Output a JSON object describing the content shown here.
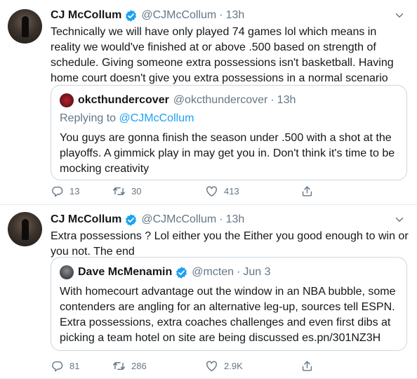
{
  "tweets": [
    {
      "author": {
        "name": "CJ McCollum",
        "handle": "@CJMcCollum"
      },
      "time": "13h",
      "text": "Technically we will have only played 74 games lol which means in reality we would've finished at or above .500 based on strength of schedule. Giving someone extra possessions isn't basketball. Having home court doesn't give you extra possessions in a normal scenario",
      "quote": {
        "author": {
          "name": "okcthundercover",
          "handle": "@okcthundercover"
        },
        "time": "13h",
        "replying_prefix": "Replying to",
        "replying_to": "@CJMcCollum",
        "text": "You guys are gonna finish the season under .500 with a shot at the playoffs. A gimmick play in may get you in. Don't think it's time to be mocking creativity"
      },
      "stats": {
        "replies": "13",
        "retweets": "30",
        "likes": "413"
      }
    },
    {
      "author": {
        "name": "CJ McCollum",
        "handle": "@CJMcCollum"
      },
      "time": "13h",
      "text": "Extra possessions ? Lol either you the Either you good enough to win or you not. The end",
      "quote": {
        "author": {
          "name": "Dave McMenamin",
          "handle": "@mcten"
        },
        "time": "Jun 3",
        "text": "With homecourt advantage out the window in an NBA bubble, some contenders are angling for an alternative leg-up, sources tell ESPN. Extra possessions, extra coaches challenges and even first dibs at picking a team hotel on site are being discussed es.pn/301NZ3H"
      },
      "stats": {
        "replies": "81",
        "retweets": "286",
        "likes": "2.9K"
      }
    }
  ],
  "separator": "·",
  "colors": {
    "accent": "#1da1f2",
    "secondary_text": "#657786",
    "border": "#ccd6dd"
  },
  "icons": [
    "verified-badge-icon",
    "caret-down-icon",
    "reply-icon",
    "retweet-icon",
    "like-icon",
    "share-icon"
  ]
}
